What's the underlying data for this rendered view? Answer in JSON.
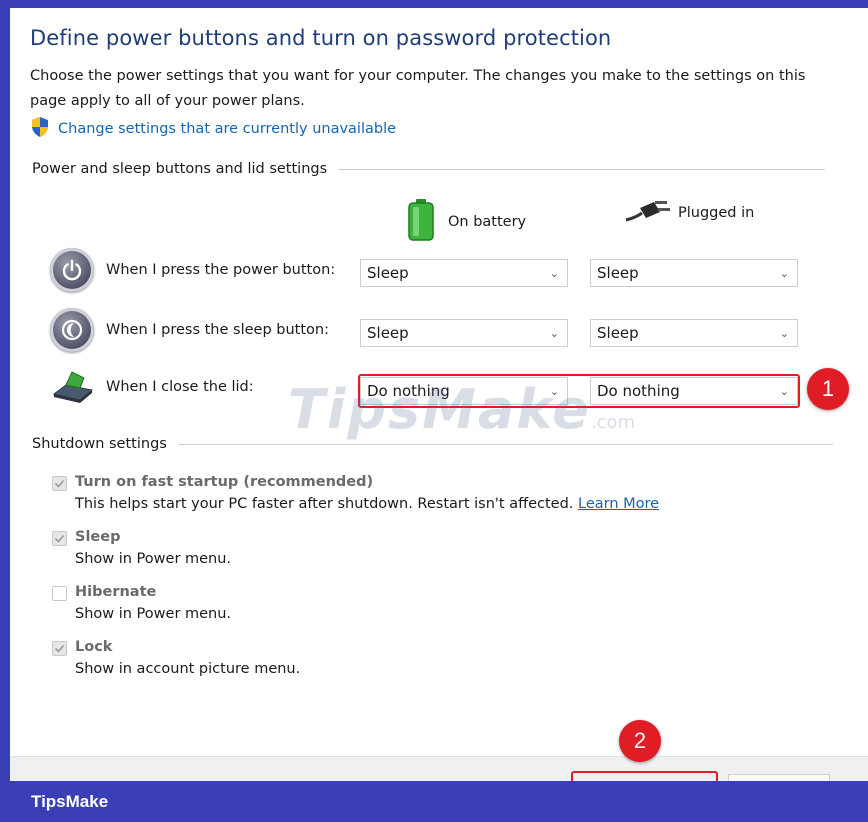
{
  "window": {
    "title": "Define power buttons and turn on password protection",
    "description": "Choose the power settings that you want for your computer. The changes you make to the settings on this page apply to all of your power plans.",
    "change_settings_link": "Change settings that are currently unavailable"
  },
  "power_section": {
    "heading": "Power and sleep buttons and lid settings",
    "columns": {
      "battery": "On battery",
      "plugged": "Plugged in"
    },
    "rows": [
      {
        "label": "When I press the power button:",
        "battery": "Sleep",
        "plugged": "Sleep",
        "icon": "power-button-icon"
      },
      {
        "label": "When I press the sleep button:",
        "battery": "Sleep",
        "plugged": "Sleep",
        "icon": "sleep-button-icon"
      },
      {
        "label": "When I close the lid:",
        "battery": "Do nothing",
        "plugged": "Do nothing",
        "icon": "laptop-lid-icon"
      }
    ]
  },
  "shutdown_section": {
    "heading": "Shutdown settings",
    "items": [
      {
        "title": "Turn on fast startup (recommended)",
        "desc": "This helps start your PC faster after shutdown. Restart isn't affected.",
        "link": "Learn More",
        "checked": true
      },
      {
        "title": "Sleep",
        "desc": "Show in Power menu.",
        "checked": true
      },
      {
        "title": "Hibernate",
        "desc": "Show in Power menu.",
        "checked": false
      },
      {
        "title": "Lock",
        "desc": "Show in account picture menu.",
        "checked": true
      }
    ]
  },
  "annotations": {
    "badge1": "1",
    "badge2": "2"
  },
  "watermark": {
    "main": "TipsMake",
    "suffix": ".com"
  },
  "footer": {
    "brand": "TipsMake"
  },
  "colors": {
    "accent_red": "#e01c24",
    "link_blue": "#1565b0",
    "title_blue": "#1f3d7a",
    "frame": "#3b3fb5"
  }
}
